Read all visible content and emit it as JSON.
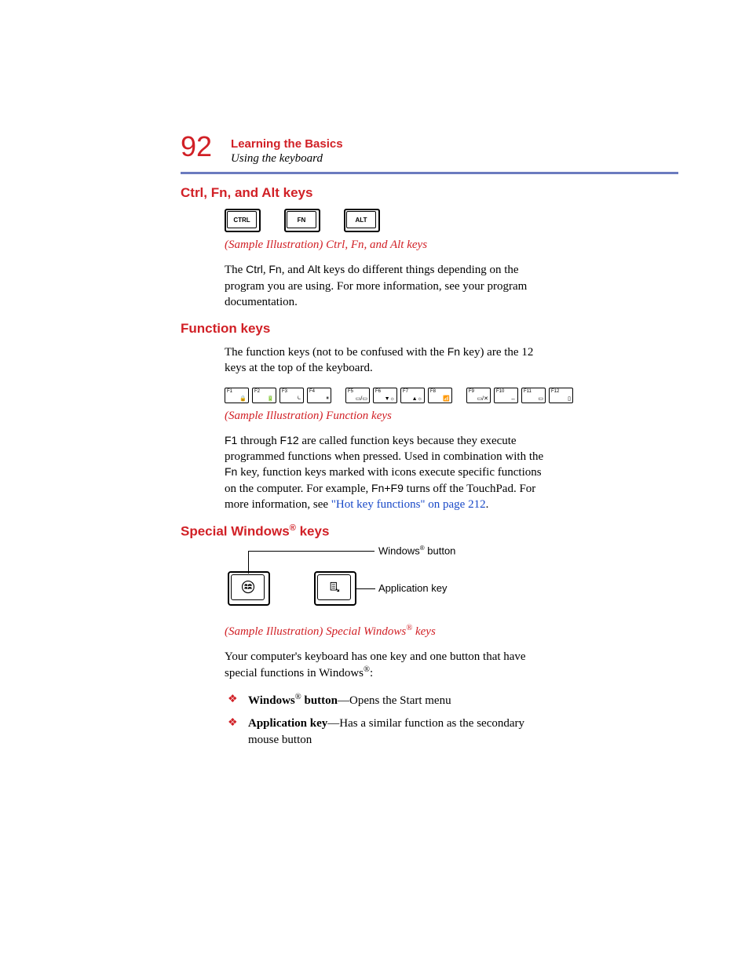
{
  "header": {
    "page_number": "92",
    "chapter": "Learning the Basics",
    "section": "Using the keyboard"
  },
  "s1": {
    "heading": "Ctrl, Fn, and Alt keys",
    "keys": {
      "k1": "CTRL",
      "k2": "FN",
      "k3": "ALT"
    },
    "caption": "(Sample Illustration) Ctrl, Fn, and Alt keys",
    "para_a": "The ",
    "para_ctrl": "Ctrl",
    "para_b": ", ",
    "para_fn": "Fn",
    "para_c": ", and ",
    "para_alt": "Alt",
    "para_d": " keys do different things depending on the program you are using. For more information, see your program documentation."
  },
  "s2": {
    "heading": "Function keys",
    "para1_a": "The function keys (not to be confused with the ",
    "para1_fn": "Fn",
    "para1_b": " key) are the 12 keys at the top of the keyboard.",
    "fk": [
      "F1",
      "F2",
      "F3",
      "F4",
      "F5",
      "F6",
      "F7",
      "F8",
      "F9",
      "F10",
      "F11",
      "F12"
    ],
    "caption": "(Sample Illustration) Function keys",
    "para2_f1": "F1",
    "para2_a": " through ",
    "para2_f12": "F12",
    "para2_b": " are called function keys because they execute programmed functions when pressed. Used in combination with the ",
    "para2_fn": "Fn",
    "para2_c": " key, function keys marked with icons execute specific functions on the computer. For example, ",
    "para2_combo": "Fn+F9",
    "para2_d": " turns off the TouchPad. For more information, see ",
    "link_text": "\"Hot key functions\" on page 212",
    "para2_e": "."
  },
  "s3": {
    "heading_a": "Special Windows",
    "heading_reg": "®",
    "heading_b": " keys",
    "label_win_a": "Windows",
    "label_win_b": " button",
    "label_app": "Application key",
    "caption_a": "(Sample Illustration) Special Windows",
    "caption_b": " keys",
    "para_a": "Your computer's keyboard has one key and one button that have special functions in Windows",
    "para_b": ":",
    "bullets": [
      {
        "strong_a": "Windows",
        "strong_b": " button",
        "rest": "—Opens the Start menu"
      },
      {
        "strong_a": "Application key",
        "strong_b": "",
        "rest": "—Has a similar function as the secondary mouse button"
      }
    ]
  }
}
